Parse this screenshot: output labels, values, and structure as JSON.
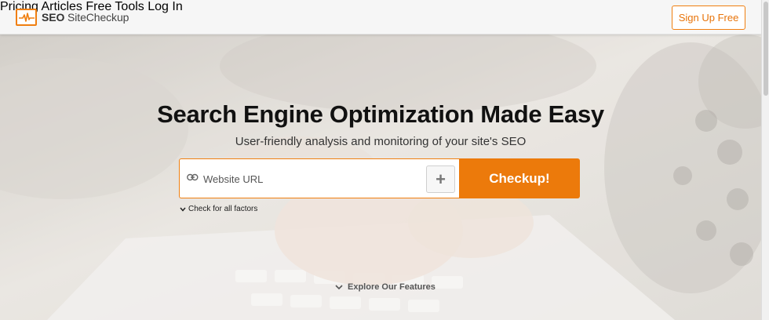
{
  "brand": {
    "name_bold": "SEO",
    "name_rest": " SiteCheckup",
    "accent_color": "#f07f10",
    "logo_icon": "pulse-monitor-icon"
  },
  "nav": {
    "items": [
      {
        "label": "Pricing"
      },
      {
        "label": "Articles"
      },
      {
        "label": "Free Tools"
      },
      {
        "label": "Log In"
      }
    ],
    "signup_label": "Sign Up Free"
  },
  "hero": {
    "title": "Search Engine Optimization Made Easy",
    "subtitle": "User-friendly analysis and monitoring of your site's SEO",
    "search": {
      "placeholder": "Website URL",
      "value": "",
      "link_icon": "link-icon",
      "plus_label": "+",
      "submit_label": "Checkup!"
    },
    "factors_label": "Check for all factors",
    "explore_label": "Explore Our Features",
    "background": "typing-on-keyboard-photo"
  },
  "colors": {
    "button_orange": "#ec7a0b",
    "header_bg": "#f6f6f6"
  }
}
